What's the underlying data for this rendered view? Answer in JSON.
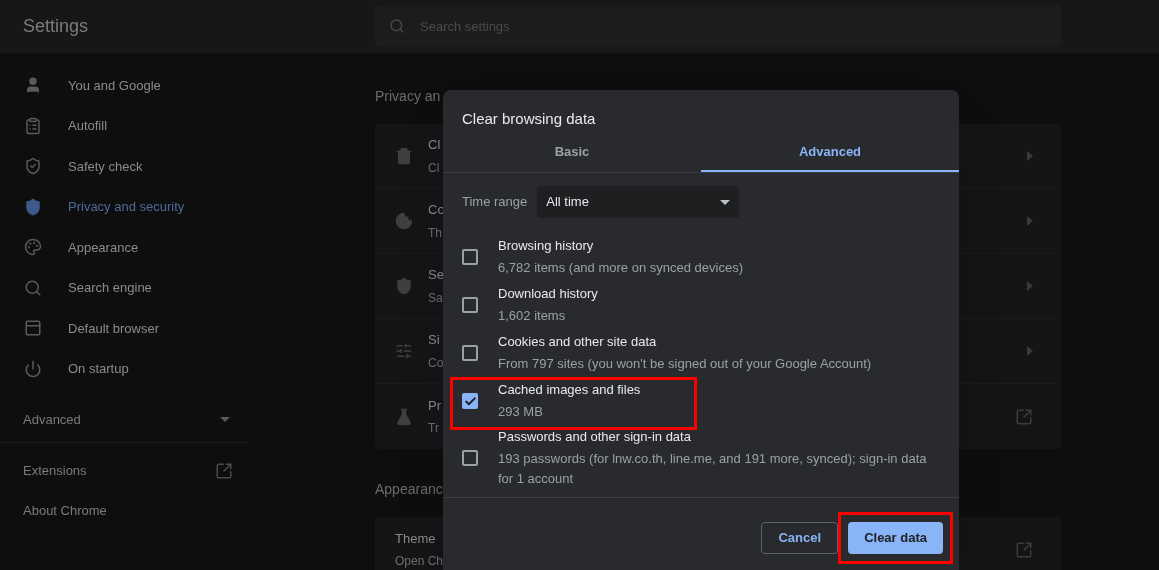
{
  "header": {
    "title": "Settings",
    "search": {
      "placeholder": "Search settings"
    }
  },
  "sidebar": {
    "items": [
      {
        "label": "You and Google",
        "selected": false
      },
      {
        "label": "Autofill",
        "selected": false
      },
      {
        "label": "Safety check",
        "selected": false
      },
      {
        "label": "Privacy and security",
        "selected": true
      },
      {
        "label": "Appearance",
        "selected": false
      },
      {
        "label": "Search engine",
        "selected": false
      },
      {
        "label": "Default browser",
        "selected": false
      },
      {
        "label": "On startup",
        "selected": false
      }
    ],
    "advanced": {
      "label": "Advanced",
      "expanded": false
    },
    "links": [
      {
        "label": "Extensions",
        "kind": "external"
      },
      {
        "label": "About Chrome",
        "kind": "internal"
      }
    ]
  },
  "sections": [
    {
      "title": "Privacy an",
      "rows": [
        {
          "title": "Cl",
          "subtitle": "Cl",
          "kind": "submenu"
        },
        {
          "title": "Co",
          "subtitle": "Th",
          "kind": "submenu"
        },
        {
          "title": "Se",
          "subtitle": "Sa",
          "kind": "submenu"
        },
        {
          "title": "Si",
          "subtitle": "Co",
          "kind": "submenu"
        },
        {
          "title": "Pr",
          "subtitle": "Tr",
          "kind": "external"
        }
      ]
    },
    {
      "title": "Appearanc",
      "rows": [
        {
          "title": "Theme",
          "subtitle": "Open Ch",
          "kind": "external"
        }
      ]
    }
  ],
  "dialog": {
    "title": "Clear browsing data",
    "tabs": [
      {
        "label": "Basic",
        "selected": false
      },
      {
        "label": "Advanced",
        "selected": true
      }
    ],
    "time_range": {
      "label": "Time range",
      "value": "All time"
    },
    "items": [
      {
        "title": "Browsing history",
        "detail": "6,782 items (and more on synced devices)",
        "checked": false,
        "highlighted": false
      },
      {
        "title": "Download history",
        "detail": "1,602 items",
        "checked": false,
        "highlighted": false
      },
      {
        "title": "Cookies and other site data",
        "detail": "From 797 sites (you won't be signed out of your Google Account)",
        "checked": false,
        "highlighted": false
      },
      {
        "title": "Cached images and files",
        "detail": "293 MB",
        "checked": true,
        "highlighted": true
      },
      {
        "title": "Passwords and other sign-in data",
        "detail": "193 passwords (for lnw.co.th, line.me, and 191 more, synced); sign-in data for 1 account",
        "checked": false,
        "highlighted": false
      }
    ],
    "buttons": [
      {
        "label": "Cancel",
        "kind": "secondary",
        "highlighted": false
      },
      {
        "label": "Clear data",
        "kind": "primary",
        "highlighted": true
      }
    ]
  }
}
